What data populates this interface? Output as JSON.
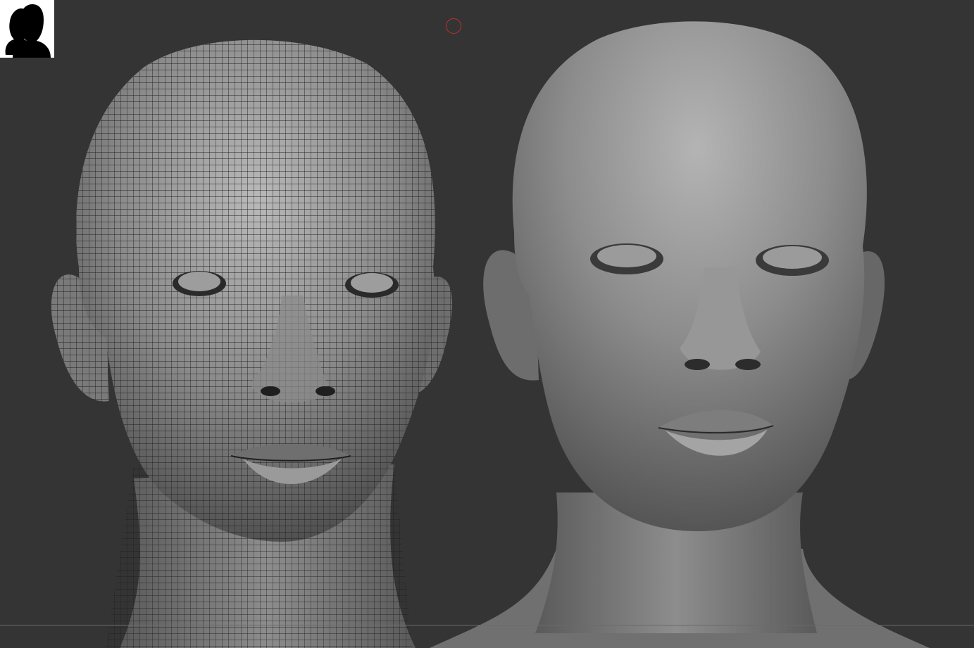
{
  "viewport": {
    "background": "#343434",
    "grid_color": "#6a6a6a"
  },
  "models": [
    {
      "name": "wireframe-head",
      "display": "polyframe",
      "shade": "#9a9a9a",
      "wire": "#1c1c1c"
    },
    {
      "name": "sculpted-head",
      "display": "smooth",
      "shade": "#8e8e8e"
    }
  ],
  "thumbnail": {
    "icon": "two-heads-silhouette-icon",
    "background": "#ffffff",
    "fill": "#000000"
  },
  "cursor": {
    "icon": "brush-cursor-icon",
    "color": "#c0302c"
  }
}
